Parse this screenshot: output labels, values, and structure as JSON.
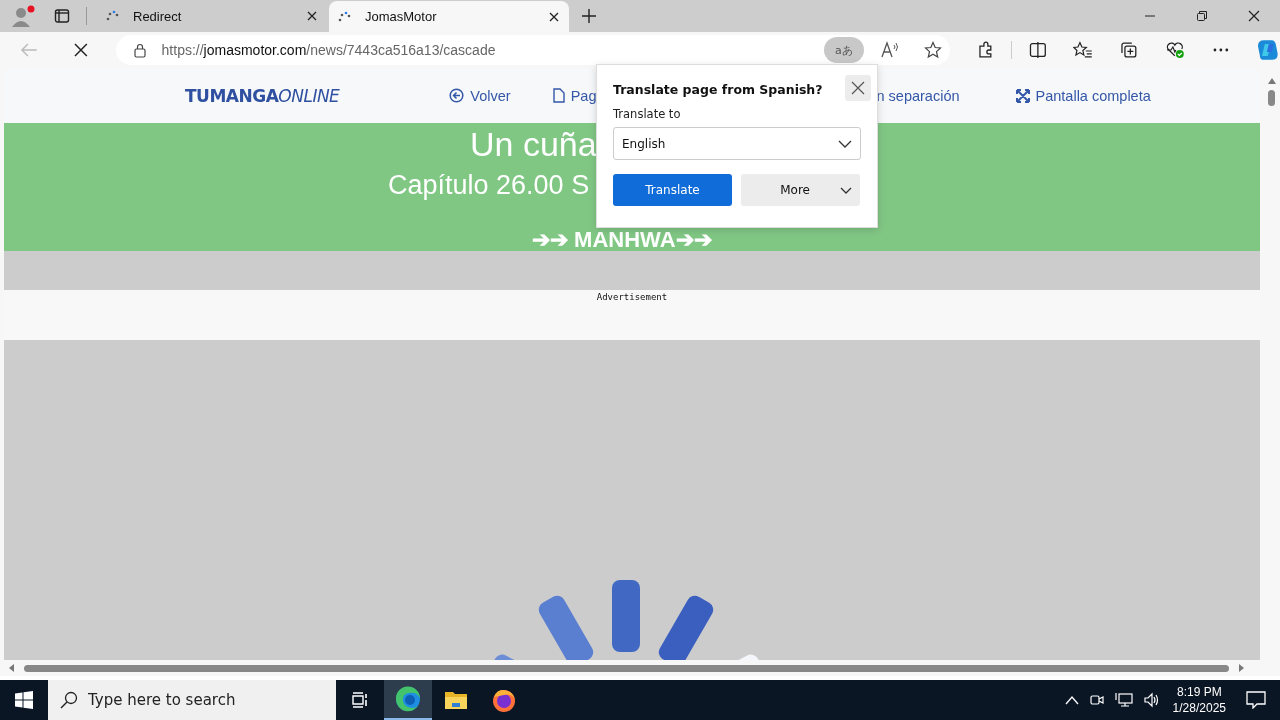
{
  "browser": {
    "tabs": [
      {
        "title": "Redirect",
        "selected": false
      },
      {
        "title": "JomasMotor",
        "selected": true
      }
    ],
    "address": {
      "prefix": "https://",
      "host": "jomasmotor.com",
      "path": "/news/7443ca516a13/cascade"
    },
    "translate_glyph": "aあ"
  },
  "site": {
    "logo_bold": "TUMANGA",
    "logo_italic": "ONLINE",
    "nav": [
      "Volver",
      "Pag",
      "n separación",
      "Pantalla completa"
    ],
    "title": "Un cuña",
    "chapter": "Capítulo 26.00 S",
    "tag": "➔➔ MANHWA➔➔",
    "ad_label": "Advertisement"
  },
  "translate_popup": {
    "title": "Translate page from Spanish?",
    "label": "Translate to",
    "language": "English",
    "primary": "Translate",
    "secondary": "More"
  },
  "taskbar": {
    "search": {
      "placeholder": "Type here to search"
    },
    "apps": [
      {
        "kind": "edge",
        "selected": true
      },
      {
        "kind": "folder",
        "selected": false
      },
      {
        "kind": "firefox",
        "selected": false
      }
    ],
    "time": "8:19 PM",
    "date": "1/28/2025"
  }
}
